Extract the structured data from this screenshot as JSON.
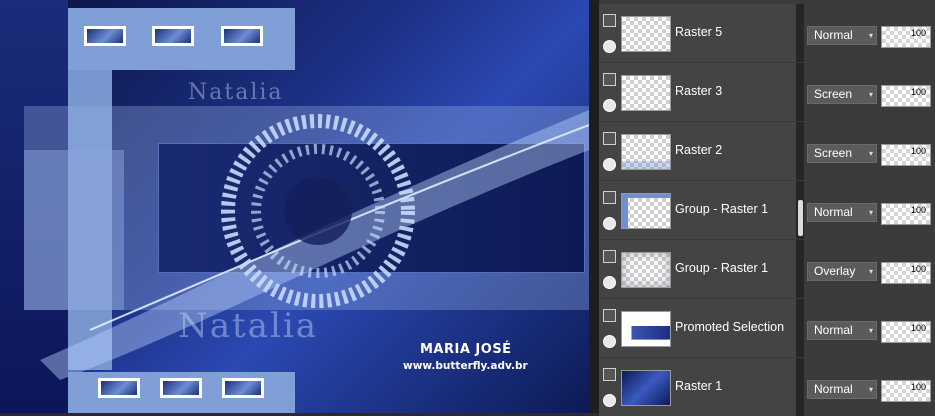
{
  "canvas": {
    "signature_name": "MARIA JOSÉ",
    "signature_url": "www.butterfly.adv.br",
    "watermark_text": "Natalia"
  },
  "layers": [
    {
      "name": "Raster 5",
      "blend": "Normal",
      "opacity": "100",
      "thumb": "checker"
    },
    {
      "name": "Raster 3",
      "blend": "Screen",
      "opacity": "100",
      "thumb": "checker-ring"
    },
    {
      "name": "Raster 2",
      "blend": "Screen",
      "opacity": "100",
      "thumb": "checker-wave"
    },
    {
      "name": "Group - Raster 1",
      "blend": "Normal",
      "opacity": "100",
      "thumb": "checker-frame"
    },
    {
      "name": "Group - Raster 1",
      "blend": "Overlay",
      "opacity": "100",
      "thumb": "checker-cloud"
    },
    {
      "name": "Promoted Selection",
      "blend": "Normal",
      "opacity": "100",
      "thumb": "blue-block"
    },
    {
      "name": "Raster 1",
      "blend": "Normal",
      "opacity": "100",
      "thumb": "blue-gradient"
    }
  ],
  "icons": {
    "layer_type": "layer-mask-icon",
    "visibility": "eye-icon",
    "dropdown": "chevron-down-icon"
  },
  "colors": {
    "panel_bg": "#3a3a3a",
    "canvas_accent": "#7f9fd6"
  }
}
